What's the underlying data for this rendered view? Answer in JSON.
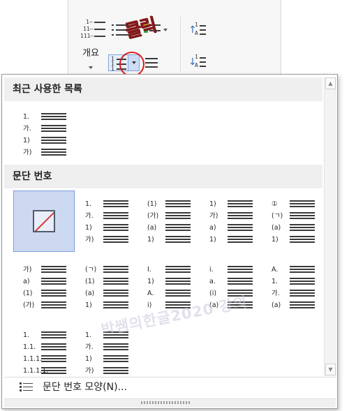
{
  "ribbon": {
    "outline_label": "개요",
    "numbering_icon_marks": [
      "1",
      "1",
      "1"
    ],
    "outline_icon_marks": [
      "1—",
      "11—",
      "111—"
    ],
    "sort_up_marks": [
      "1",
      "A"
    ],
    "sort_down_marks": [
      "1",
      "A"
    ],
    "annotation_text": "클릭",
    "highlight_color": "#e01818"
  },
  "panel": {
    "recent_header": "최근 사용한 목록",
    "numbering_header": "문단 번호",
    "recent_items": [
      {
        "labels": [
          "1.",
          "가.",
          "1)",
          "가)"
        ]
      }
    ],
    "numbering_items": [
      {
        "labels": [],
        "type": "none"
      },
      {
        "labels": [
          "1.",
          "가.",
          "1)",
          "가)"
        ]
      },
      {
        "labels": [
          "(1)",
          "(가)",
          "(a)",
          "1)"
        ]
      },
      {
        "labels": [
          "1)",
          "가)",
          "a)",
          "1)"
        ]
      },
      {
        "labels": [
          "①",
          "(ㄱ)",
          "(a)",
          "1)"
        ]
      },
      {
        "labels": [
          "가)",
          "a)",
          "(1)",
          "(가)"
        ]
      },
      {
        "labels": [
          "(ㄱ)",
          "(1)",
          "(a)",
          "1)"
        ]
      },
      {
        "labels": [
          "I.",
          "1)",
          "A.",
          "i)"
        ]
      },
      {
        "labels": [
          "i.",
          "a.",
          "(i)",
          "(a)"
        ]
      },
      {
        "labels": [
          "A.",
          "1.",
          "가.",
          "(a)"
        ]
      },
      {
        "labels": [
          "1.",
          "1.1.",
          "1.1.1.",
          "1.1.1.1."
        ]
      },
      {
        "labels": [
          "1.",
          "가.",
          "1)",
          "가)"
        ]
      }
    ],
    "footer_label": "문단 번호 모양(N)...",
    "selected_color": "#ccd9f1"
  },
  "watermark": "박쌤의한글2020 강의",
  "icons": {
    "numbering_icon": "numbered-list-icon",
    "outline_icon": "outline-numbering-icon",
    "bullet_icon": "bullet-list-icon",
    "footer_icon": "paragraph-numbering-format-icon",
    "scroll_up": "arrow-up-icon",
    "scroll_down": "arrow-down-icon"
  }
}
